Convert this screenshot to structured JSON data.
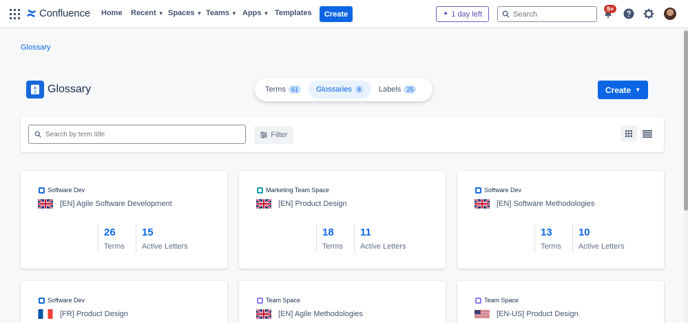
{
  "nav": {
    "brand": "Confluence",
    "items": [
      {
        "label": "Home",
        "dropdown": false
      },
      {
        "label": "Recent",
        "dropdown": true
      },
      {
        "label": "Spaces",
        "dropdown": true
      },
      {
        "label": "Teams",
        "dropdown": true
      },
      {
        "label": "Apps",
        "dropdown": true
      },
      {
        "label": "Templates",
        "dropdown": false
      }
    ],
    "create_label": "Create",
    "trial_label": "1 day left",
    "search_placeholder": "Search",
    "notification_badge": "9+"
  },
  "breadcrumb": "Glossary",
  "page_title": "Glossary",
  "tabs": [
    {
      "label": "Terms",
      "count": "61",
      "active": false
    },
    {
      "label": "Glossaries",
      "count": "8",
      "active": true
    },
    {
      "label": "Labels",
      "count": "25",
      "active": false
    }
  ],
  "create_button_label": "Create",
  "search": {
    "placeholder": "Search by term title"
  },
  "filter_label": "Filter",
  "cards": [
    {
      "space": "Software Dev",
      "space_color": "#1868db",
      "flag": "uk",
      "title": "[EN] Agile Software Development",
      "terms": "26",
      "terms_label": "Terms",
      "letters": "15",
      "letters_label": "Active Letters"
    },
    {
      "space": "Marketing Team Space",
      "space_color": "#1d9aaa",
      "flag": "uk",
      "title": "[EN] Product Design",
      "terms": "18",
      "terms_label": "Terms",
      "letters": "11",
      "letters_label": "Active Letters"
    },
    {
      "space": "Software Dev",
      "space_color": "#1868db",
      "flag": "uk",
      "title": "[EN] Software Methodologies",
      "terms": "13",
      "terms_label": "Terms",
      "letters": "10",
      "letters_label": "Active Letters"
    },
    {
      "space": "Software Dev",
      "space_color": "#1868db",
      "flag": "fr",
      "title": "[FR] Product Design"
    },
    {
      "space": "Team Space",
      "space_color": "#8f7ee7",
      "flag": "uk",
      "title": "[EN] Agile Methodologies"
    },
    {
      "space": "Team Space",
      "space_color": "#8f7ee7",
      "flag": "us",
      "title": "[EN-US] Product Design"
    }
  ],
  "colors": {
    "primary": "#0c66e4",
    "trial": "#6e5dc6",
    "badge": "#c9372c"
  }
}
